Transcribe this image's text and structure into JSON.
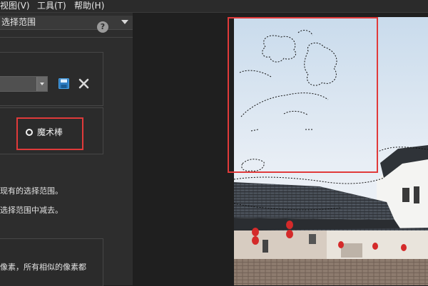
{
  "menu": {
    "view": "视图(V)",
    "tools": "工具(T)",
    "help": "帮助(H)"
  },
  "panel": {
    "title": "选择范围",
    "help_glyph": "?",
    "dropdown_value": "",
    "radio_label": "魔术棒",
    "desc_lines": [
      "现有的选择范围。",
      "选择范围中减去。",
      "像素，所有相似的像素都"
    ]
  },
  "colors": {
    "highlight_red": "#e03a3a",
    "save_icon_blue": "#4aa3e6",
    "panel_bg": "#2d2d2d",
    "workspace_bg": "#1f1f1f"
  },
  "icons": [
    "save-icon",
    "close-icon",
    "help-icon",
    "chevron-down-icon",
    "radio-selected-icon"
  ]
}
